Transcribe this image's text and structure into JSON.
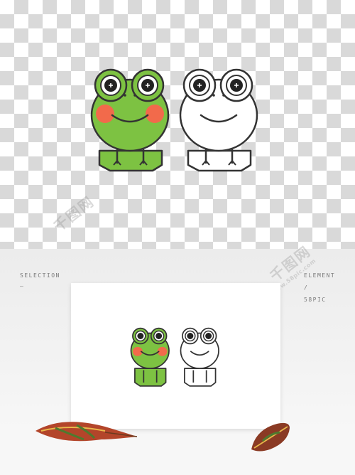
{
  "labels": {
    "left_top": "SELECTION",
    "left_dash": "—",
    "right_top": "ELEMENT",
    "right_slash": "/",
    "right_bottom": "58PIC"
  },
  "watermark": {
    "brand": "千图网",
    "url": "www.58pic.com"
  },
  "colors": {
    "frog_green": "#7dc242",
    "cheek": "#f26a4b",
    "outline": "#333333",
    "leaf_red": "#b3452a",
    "leaf_green": "#4e7a2e"
  }
}
